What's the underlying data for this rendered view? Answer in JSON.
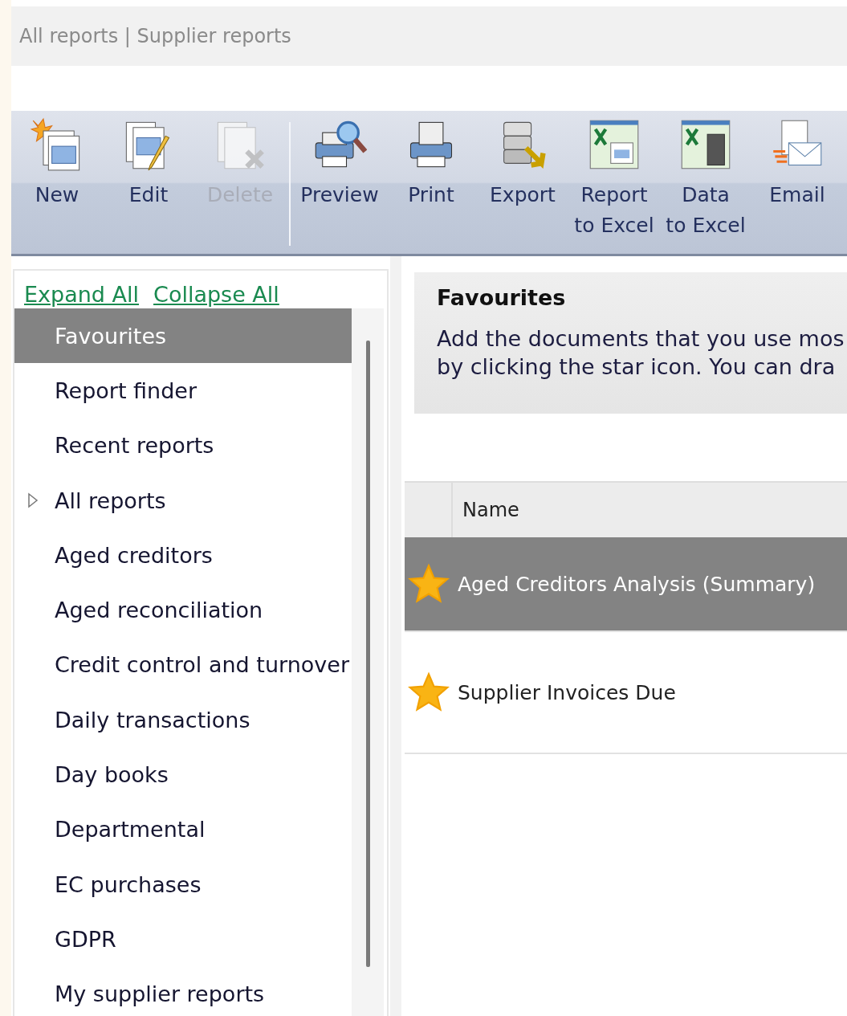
{
  "breadcrumb": "All reports | Supplier reports",
  "toolbar": [
    {
      "kind": "new",
      "label": "New",
      "disabled": false
    },
    {
      "kind": "edit",
      "label": "Edit",
      "disabled": false
    },
    {
      "kind": "delete",
      "label": "Delete",
      "disabled": true
    },
    {
      "kind": "separator"
    },
    {
      "kind": "preview",
      "label": "Preview",
      "disabled": false
    },
    {
      "kind": "print",
      "label": "Print",
      "disabled": false
    },
    {
      "kind": "export",
      "label": "Export",
      "disabled": false
    },
    {
      "kind": "report-excel",
      "label": "Report to Excel",
      "disabled": false
    },
    {
      "kind": "data-excel",
      "label": "Data to Excel",
      "disabled": false
    },
    {
      "kind": "email",
      "label": "Email",
      "disabled": false
    }
  ],
  "tree_links": [
    "Expand All",
    "Collapse All"
  ],
  "tree": [
    {
      "label": "Favourites",
      "selected": true
    },
    {
      "label": "Report finder",
      "selected": false
    },
    {
      "label": "Recent reports",
      "selected": false
    },
    {
      "label": "All reports",
      "selected": false,
      "expanded": false
    },
    {
      "label": "Aged creditors",
      "selected": false
    },
    {
      "label": "Aged reconciliation",
      "selected": false
    },
    {
      "label": "Credit control and turnover",
      "selected": false
    },
    {
      "label": "Daily transactions",
      "selected": false
    },
    {
      "label": "Day books",
      "selected": false
    },
    {
      "label": "Departmental",
      "selected": false
    },
    {
      "label": "EC purchases",
      "selected": false
    },
    {
      "label": "GDPR",
      "selected": false
    },
    {
      "label": "My supplier reports",
      "selected": false
    }
  ],
  "info": {
    "title": "Favourites",
    "text": "Add the documents that you use mos\nby clicking the star icon. You can dra"
  },
  "table": {
    "columns": [
      "Name"
    ],
    "rows": [
      {
        "name": "Aged Creditors Analysis (Summary)",
        "favourite": true,
        "selected": true
      },
      {
        "name": "Supplier Invoices Due",
        "favourite": true,
        "selected": false
      }
    ]
  }
}
